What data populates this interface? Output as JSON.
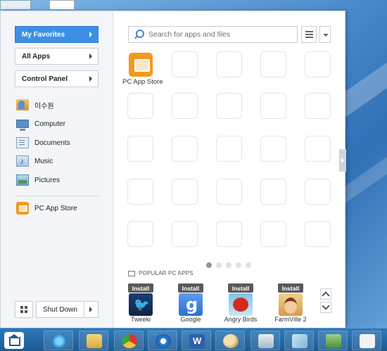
{
  "left_nav": {
    "my_favorites": "My Favorites",
    "all_apps": "All Apps",
    "control_panel": "Control Panel"
  },
  "places": [
    {
      "label": "이수원",
      "icon": "user-folder-icon"
    },
    {
      "label": "Computer",
      "icon": "computer-icon"
    },
    {
      "label": "Documents",
      "icon": "documents-icon"
    },
    {
      "label": "Music",
      "icon": "music-icon"
    },
    {
      "label": "Pictures",
      "icon": "pictures-icon"
    }
  ],
  "pinned": {
    "label": "PC App Store",
    "icon": "pc-app-store-icon"
  },
  "shutdown": {
    "label": "Shut Down"
  },
  "search": {
    "placeholder": "Search for apps and files"
  },
  "grid": {
    "first_tile_label": "PC App Store",
    "pages": 5,
    "current_page": 1
  },
  "popular": {
    "title": "POPULAR PC APPS",
    "install_label": "Install",
    "apps": [
      {
        "label": "Tweeki",
        "icon": "tweeki-icon"
      },
      {
        "label": "Google",
        "icon": "google-icon"
      },
      {
        "label": "Angry Birds",
        "icon": "angry-birds-icon"
      },
      {
        "label": "FarmVille 2",
        "icon": "farmville-icon"
      }
    ]
  },
  "colors": {
    "accent": "#3d8fe6",
    "store_orange": "#f39a1e",
    "taskbar": "#2e78b8"
  },
  "taskbar": {
    "items": [
      "start-icon",
      "internet-explorer-icon",
      "file-explorer-icon",
      "chrome-icon",
      "itunes-icon",
      "word-icon",
      "paint-icon",
      "calculator-icon",
      "files-icon",
      "photo-icon",
      "games-icon"
    ]
  }
}
